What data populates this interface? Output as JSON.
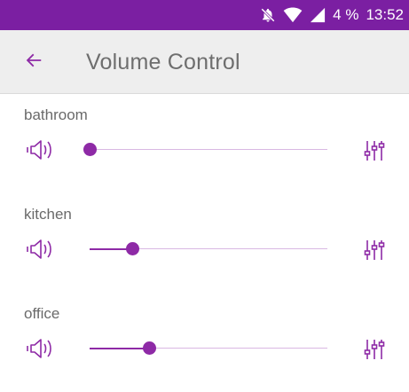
{
  "status": {
    "battery": "4 %",
    "time": "13:52"
  },
  "appbar": {
    "title": "Volume Control"
  },
  "colors": {
    "statusbar": "#7b1fa2",
    "accent": "#8e2aa6",
    "track": "#d9b8e3"
  },
  "rooms": [
    {
      "name": "bathroom",
      "volume": 0.0
    },
    {
      "name": "kitchen",
      "volume": 0.18
    },
    {
      "name": "office",
      "volume": 0.25
    }
  ],
  "icons": {
    "back": "arrow-back-icon",
    "speaker": "speaker-icon",
    "equalizer": "equalizer-icon",
    "mute": "notifications-off-icon",
    "wifi": "wifi-icon",
    "signal": "signal-icon"
  }
}
